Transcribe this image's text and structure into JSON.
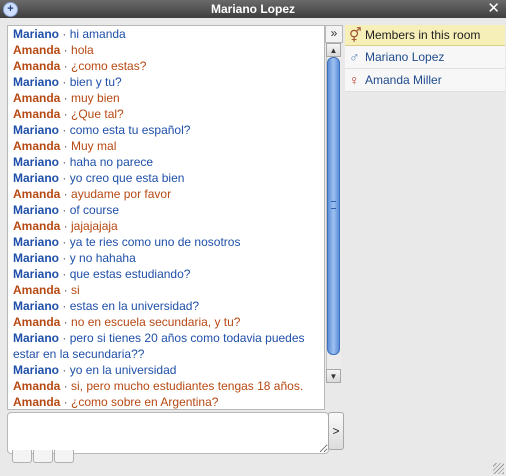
{
  "window": {
    "title": "Mariano Lopez",
    "left_icon": "+",
    "close_icon": "✕"
  },
  "toggle": {
    "glyph": "»"
  },
  "scrollbar": {
    "up": "▲",
    "down": "▼"
  },
  "members": {
    "header": "Members in this room",
    "header_icon": "⚥",
    "list": [
      {
        "name": "Mariano Lopez",
        "icon": "♂"
      },
      {
        "name": "Amanda Miller",
        "icon": "♀"
      }
    ]
  },
  "messages": [
    {
      "sender": "Mariano",
      "text": "hi amanda"
    },
    {
      "sender": "Amanda",
      "text": "hola"
    },
    {
      "sender": "Amanda",
      "text": "¿como estas?"
    },
    {
      "sender": "Mariano",
      "text": "bien y tu?"
    },
    {
      "sender": "Amanda",
      "text": "muy bien"
    },
    {
      "sender": "Amanda",
      "text": "¿Que tal?"
    },
    {
      "sender": "Mariano",
      "text": "como esta tu español?"
    },
    {
      "sender": "Amanda",
      "text": "Muy mal"
    },
    {
      "sender": "Mariano",
      "text": "haha no parece"
    },
    {
      "sender": "Mariano",
      "text": "yo creo que esta  bien"
    },
    {
      "sender": "Amanda",
      "text": "ayudame por favor"
    },
    {
      "sender": "Mariano",
      "text": "of course"
    },
    {
      "sender": "Amanda",
      "text": "jajajajaja"
    },
    {
      "sender": "Mariano",
      "text": "ya te ries como uno de nosotros"
    },
    {
      "sender": "Mariano",
      "text": "y no hahaha"
    },
    {
      "sender": "Mariano",
      "text": "que estas estudiando?"
    },
    {
      "sender": "Amanda",
      "text": "si"
    },
    {
      "sender": "Mariano",
      "text": "estas en la universidad?"
    },
    {
      "sender": "Amanda",
      "text": "no en escuela secundaria, y tu?"
    },
    {
      "sender": "Mariano",
      "text": "pero si tienes 20 años como todavia puedes estar en la secundaria??"
    },
    {
      "sender": "Mariano",
      "text": "yo en la universidad"
    },
    {
      "sender": "Amanda",
      "text": "si, pero mucho estudiantes tengas 18 años."
    },
    {
      "sender": "Amanda",
      "text": "¿como sobre en Argentina?"
    }
  ],
  "composer": {
    "value": "",
    "send_label": ">"
  },
  "colors": {
    "mariano": "#1f4fa8",
    "amanda": "#b74913",
    "members_header_bg": "#f6efb7"
  }
}
